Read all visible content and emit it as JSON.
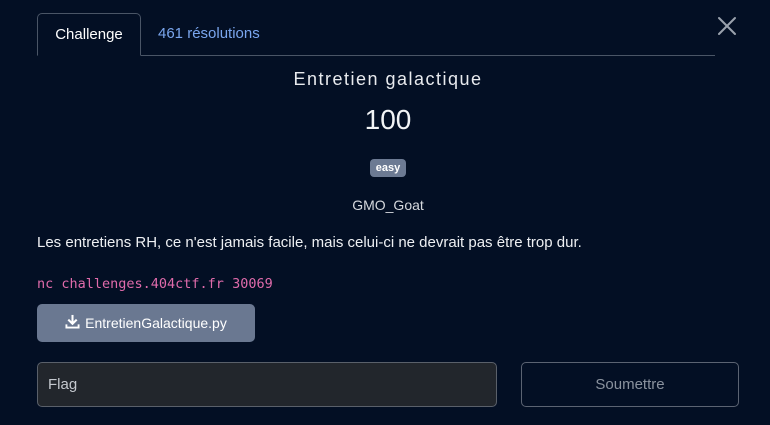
{
  "tabs": {
    "challenge_label": "Challenge",
    "solves_label": "461 résolutions"
  },
  "challenge": {
    "name": "Entretien galactique",
    "value": "100",
    "difficulty": "easy",
    "author": "GMO_Goat",
    "description": "Les entretiens RH, ce n'est jamais facile, mais celui-ci ne devrait pas être trop dur.",
    "connection": "nc challenges.404ctf.fr 30069",
    "file_name": "EntretienGalactique.py"
  },
  "form": {
    "flag_placeholder": "Flag",
    "submit_label": "Soumettre"
  },
  "icons": {
    "close": "close-icon",
    "download": "download-icon"
  },
  "colors": {
    "background": "#030f24",
    "link": "#7aa6ee",
    "badge": "#6c7a93",
    "code": "#e06bab"
  }
}
